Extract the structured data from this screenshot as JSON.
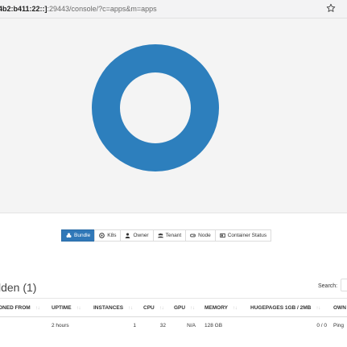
{
  "browser": {
    "url_host": "4b2:b411:22::]",
    "url_rest": ":29443/console/?c=apps&m=apps",
    "bookmark_icon": "star-icon"
  },
  "chart_data": {
    "type": "pie",
    "style": "donut",
    "slices": [
      {
        "value": 1,
        "color": "#2d7fbd"
      }
    ],
    "background": "#f4f4f4"
  },
  "filters": [
    {
      "label": "Bundle",
      "icon": "bundle-icon",
      "active": true
    },
    {
      "label": "K8s",
      "icon": "k8s-icon",
      "active": false
    },
    {
      "label": "Owner",
      "icon": "owner-icon",
      "active": false
    },
    {
      "label": "Tenant",
      "icon": "tenant-icon",
      "active": false
    },
    {
      "label": "Node",
      "icon": "node-icon",
      "active": false
    },
    {
      "label": "Container Status",
      "icon": "container-icon",
      "active": false
    }
  ],
  "section": {
    "title": "lden (1)",
    "search_label": "Search:",
    "search_value": ""
  },
  "table": {
    "columns": [
      "ONED FROM",
      "UPTIME",
      "INSTANCES",
      "CPU",
      "GPU",
      "MEMORY",
      "HUGEPAGES 1GB / 2MB",
      "OWN"
    ],
    "rows": [
      [
        "",
        "2 hours",
        "1",
        "32",
        "N/A",
        "128 GB",
        "0 / 0",
        "Ping"
      ]
    ]
  },
  "colors": {
    "accent": "#3078b8",
    "donut": "#2d7fbd"
  }
}
